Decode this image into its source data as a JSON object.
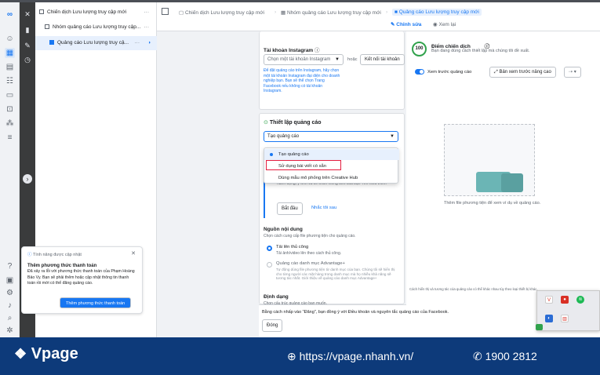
{
  "tree": {
    "items": [
      {
        "label": "Chiến dịch Lưu lượng truy cập mới"
      },
      {
        "label": "Nhóm quảng cáo Lưu lượng truy cập..."
      },
      {
        "label": "Quảng cáo Lưu lượng truy cậ..."
      }
    ],
    "more": "···"
  },
  "notification": {
    "header": "Tính năng được cập nhật",
    "title": "Thêm phương thức thanh toán",
    "body": "Đã xảy ra lỗi với phương thức thanh toán của Phạm Hoàng Bảo Vy. Bạn sẽ phải thêm hoặc cập nhật thông tin thanh toán rồi mới có thể đăng quảng cáo.",
    "button": "Thêm phương thức thanh toán"
  },
  "breadcrumb": {
    "c1": "Chiến dịch Lưu lượng truy cập mới",
    "c2": "Nhóm quảng cáo Lưu lượng truy cập mới",
    "c3": "Quảng cáo Lưu lượng truy cập mới",
    "edit": "Chỉnh sửa",
    "view": "Xem lại"
  },
  "editor": {
    "ig_title": "Tài khoản Instagram",
    "ig_select": "Chọn một tài khoản Instagram",
    "or": "hoặc",
    "ig_connect": "Kết nối tài khoản",
    "ig_help": "Để đặt quảng cáo trên Instagram, hãy chọn một tài khoản Instagram đại diện cho doanh nghiệp bạn. Bạn sẽ thể chọn Trang Facebook nếu không có tài khoản Instagram.",
    "setup_title": "Thiết lập quảng cáo",
    "setup_select": "Tạo quảng cáo",
    "options": [
      "Tạo quảng cáo",
      "Sử dụng bài viết có sẵn",
      "Dùng mẫu mô phỏng trên Creative Hub"
    ],
    "hidden_text": "hành động, ý tình và sẽ thích hiếng biết của bạn Tìm hiểu thêm",
    "start": "Bắt đầu",
    "remind": "Nhắc tôi sau",
    "source_title": "Nguồn nội dung",
    "source_desc": "Chọn cách cung cấp file phương tiện cho quảng cáo.",
    "upload": "Tải lên thủ công",
    "upload_desc": "Tải ảnh/video lên theo cách thủ công.",
    "catalog": "Quảng cáo danh mục Advantage+",
    "catalog_desc": "Tự động dùng file phương tiện từ danh mục của bạn. Chúng tôi sẽ hiển thị cho từng người các mặt hàng trong danh mục mà họ nhiều khả năng sẽ tương tác nhất. Giới thiệu về quảng cáo danh mục Advantage+",
    "format_title": "Định dạng",
    "format_desc": "Chọn cấu trúc quảng cáo bạn muốn.",
    "footer_text": "Bằng cách nhấp vào \"Đăng\", bạn đồng ý với Điều khoản và nguyên tắc quảng cáo của Facebook.",
    "close": "Đóng"
  },
  "preview": {
    "score": "100",
    "score_title": "Điểm chiến dịch",
    "score_desc": "Bạn đang dùng cách thiết lập mà chúng tôi đề xuất.",
    "toggle_label": "Xem trước quảng cáo",
    "advanced": "Bản xem trước nâng cao",
    "placeholder": "Thêm file phương tiện để xem ví dụ về quảng cáo.",
    "note": "Cách hiển thị và tương tác của quảng cáo có thể khác nhau tùy theo loại thiết bị khác."
  },
  "brand": {
    "logo": "Vpage",
    "url": "https://vpage.nhanh.vn/",
    "phone": "1900 2812"
  },
  "colors": {
    "accent": "#1877f2",
    "band": "#0d3a7a",
    "highlight": "#e41e3f"
  }
}
